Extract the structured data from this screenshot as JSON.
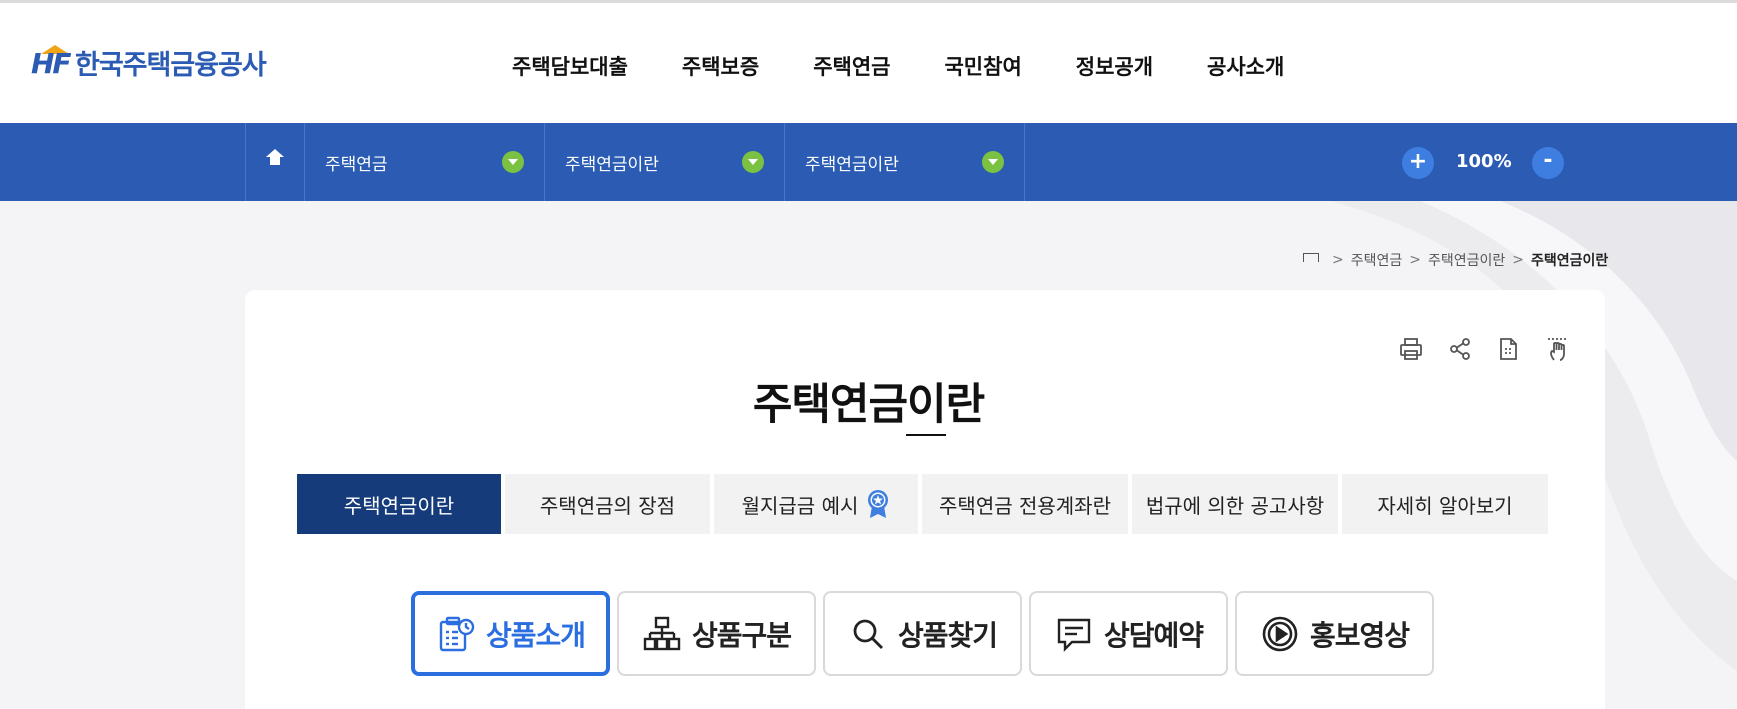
{
  "brand": {
    "name": "한국주택금융공사",
    "mark": "HF",
    "color": "#2b5bb3",
    "accent": "#f2a418"
  },
  "nav": {
    "items": [
      "주택담보대출",
      "주택보증",
      "주택연금",
      "국민참여",
      "정보공개",
      "공사소개"
    ]
  },
  "location": {
    "home_icon": "home-icon",
    "segments": [
      "주택연금",
      "주택연금이란",
      "주택연금이란"
    ],
    "zoom_in_label": "+",
    "zoom_out_label": "-",
    "zoom_value": "100%",
    "bar_color": "#2b5bb3",
    "drop_color": "#7cc242"
  },
  "breadcrumb": {
    "items": [
      "주택연금",
      "주택연금이란"
    ],
    "current": "주택연금이란",
    "separator": ">"
  },
  "utilities": [
    "print-icon",
    "share-icon",
    "document-download-icon",
    "touch-gesture-icon"
  ],
  "page": {
    "title": "주택연금이란"
  },
  "tabs": [
    "주택연금이란",
    "주택연금의 장점",
    "월지급금 예시",
    "주택연금 전용계좌란",
    "법규에 의한 공고사항",
    "자세히 알아보기"
  ],
  "active_tab": 0,
  "pills": [
    "상품소개",
    "상품구분",
    "상품찾기",
    "상담예약",
    "홍보영상"
  ],
  "active_pill": 0
}
